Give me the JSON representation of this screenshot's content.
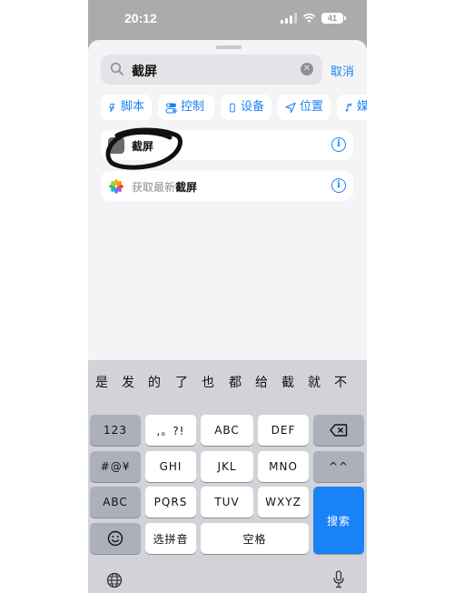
{
  "status_bar": {
    "time": "20:12",
    "battery": "41"
  },
  "search": {
    "query": "截屏",
    "cancel_label": "取消"
  },
  "categories": [
    {
      "label": "脚本",
      "icon": "script-icon"
    },
    {
      "label": "控制",
      "icon": "toggle-icon"
    },
    {
      "label": "设备",
      "icon": "phone-icon"
    },
    {
      "label": "位置",
      "icon": "location-arrow-icon"
    },
    {
      "label": "媒体",
      "icon": "music-note-icon"
    }
  ],
  "results": [
    {
      "title": "截屏",
      "icon": "screenshot-icon"
    },
    {
      "prefix": "获取最新",
      "highlight": "截屏",
      "icon": "photos-icon"
    }
  ],
  "keyboard": {
    "candidates": [
      "是",
      "发",
      "的",
      "了",
      "也",
      "都",
      "给",
      "截",
      "就",
      "不"
    ],
    "keys": {
      "num": "123",
      "punct": ",。?!",
      "abc": "ABC",
      "def": "DEF",
      "symbols": "#@¥",
      "ghi": "GHI",
      "jkl": "JKL",
      "mno": "MNO",
      "caret": "^^",
      "abc_switch": "ABC",
      "pqrs": "PQRS",
      "tuv": "TUV",
      "wxyz": "WXYZ",
      "search": "搜索",
      "pinyin": "选拼音",
      "space": "空格"
    }
  },
  "colors": {
    "accent": "#1a82f7",
    "sheet_background": "#f4f4f6",
    "keyboard_background": "#d1d3d8"
  }
}
